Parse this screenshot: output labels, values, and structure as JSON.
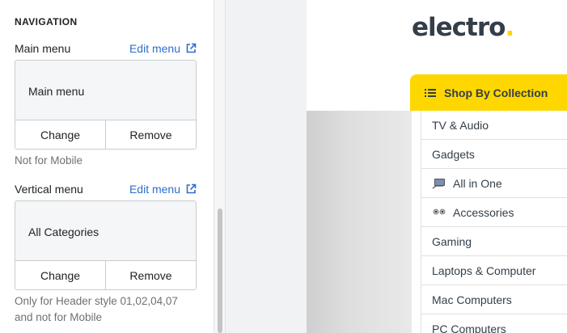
{
  "settings": {
    "section_title": "NAVIGATION",
    "main_menu": {
      "label": "Main menu",
      "edit_link": "Edit menu",
      "value": "Main menu",
      "change_button": "Change",
      "remove_button": "Remove",
      "help": "Not for Mobile"
    },
    "vertical_menu": {
      "label": "Vertical menu",
      "edit_link": "Edit menu",
      "value": "All Categories",
      "change_button": "Change",
      "remove_button": "Remove",
      "help_line1": "Only for Header style 01,02,04,07",
      "help_line2": "and not for Mobile"
    }
  },
  "preview": {
    "logo_text": "electro",
    "logo_dot": ".",
    "collection_button": "Shop By Collection",
    "categories": [
      {
        "label": "TV & Audio",
        "icon": ""
      },
      {
        "label": "Gadgets",
        "icon": ""
      },
      {
        "label": "All in One",
        "icon": "computer-icon"
      },
      {
        "label": "Accessories",
        "icon": "earbuds-icon"
      },
      {
        "label": "Gaming",
        "icon": ""
      },
      {
        "label": "Laptops & Computer",
        "icon": ""
      },
      {
        "label": "Mac Computers",
        "icon": ""
      },
      {
        "label": "PC Computers",
        "icon": ""
      }
    ]
  },
  "colors": {
    "link": "#2c6ecb",
    "brand_yellow": "#fed700",
    "brand_dark": "#333e48"
  }
}
